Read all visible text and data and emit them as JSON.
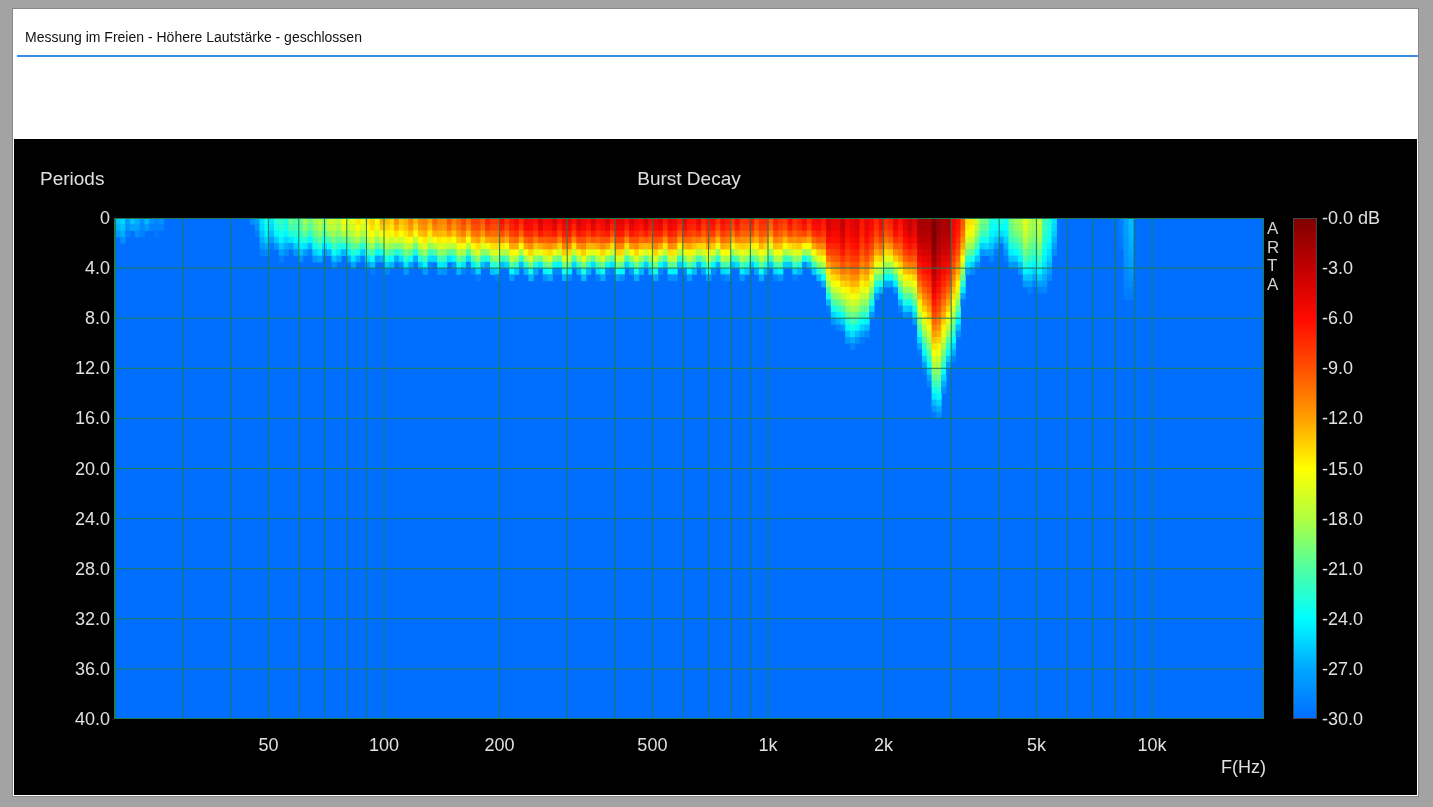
{
  "title_field": {
    "value": "Messung im Freien - Höhere Lautstärke - geschlossen"
  },
  "chart": {
    "title": "Burst Decay",
    "y_axis_label": "Periods",
    "x_axis_label": "F(Hz)",
    "side_label": "ARTA",
    "y_ticks": [
      "0",
      "4.0",
      "8.0",
      "12.0",
      "16.0",
      "20.0",
      "24.0",
      "28.0",
      "32.0",
      "36.0",
      "40.0"
    ],
    "x_ticks": [
      "50",
      "100",
      "200",
      "500",
      "1k",
      "2k",
      "5k",
      "10k"
    ],
    "color_scale": [
      "-0.0 dB",
      "-3.0",
      "-6.0",
      "-9.0",
      "-12.0",
      "-15.0",
      "-18.0",
      "-21.0",
      "-24.0",
      "-27.0",
      "-30.0"
    ]
  }
}
